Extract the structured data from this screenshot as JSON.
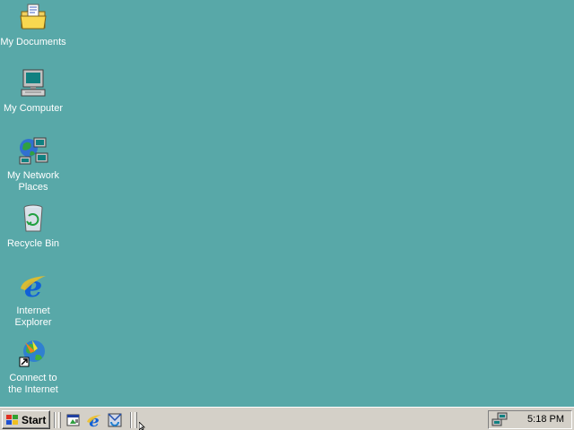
{
  "desktop": {
    "background": "#58a8a8",
    "icons": [
      {
        "label": "My Documents",
        "icon": "folder-documents-icon"
      },
      {
        "label": "My Computer",
        "icon": "computer-icon"
      },
      {
        "label": "My Network\nPlaces",
        "icon": "network-places-icon"
      },
      {
        "label": "Recycle Bin",
        "icon": "recycle-bin-icon"
      },
      {
        "label": "Internet\nExplorer",
        "icon": "internet-explorer-icon"
      },
      {
        "label": "Connect to\nthe Internet",
        "icon": "connect-internet-icon"
      }
    ]
  },
  "taskbar": {
    "start_label": "Start",
    "quick_launch": [
      "show-desktop-icon",
      "internet-explorer-icon",
      "outlook-express-icon"
    ],
    "tray": {
      "icon": "network-status-icon",
      "clock": "5:18 PM"
    }
  }
}
